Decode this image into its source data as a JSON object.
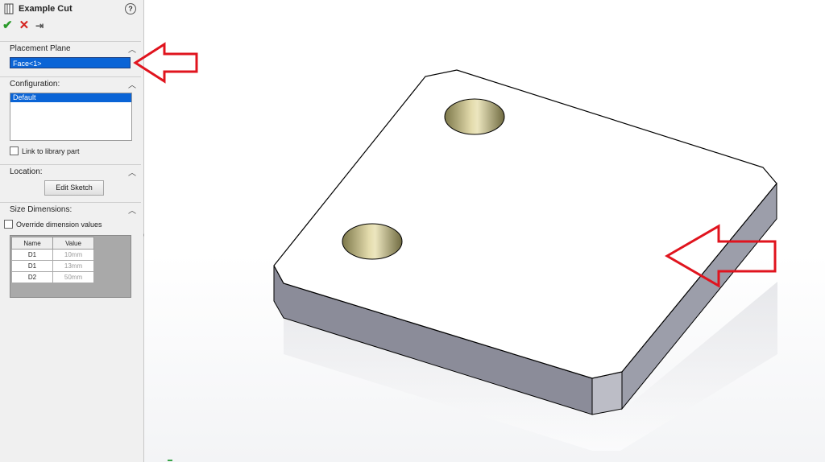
{
  "panel": {
    "title": "Example Cut",
    "help_glyph": "?",
    "actions": {
      "ok": "✔",
      "cancel": "✕",
      "pin": "⇥"
    }
  },
  "placement_plane": {
    "label": "Placement Plane",
    "value": "Face<1>"
  },
  "configuration": {
    "label": "Configuration:",
    "items": [
      "Default"
    ],
    "link_label": "Link to library part"
  },
  "location": {
    "label": "Location:",
    "edit_sketch": "Edit Sketch"
  },
  "size_dimensions": {
    "label": "Size Dimensions:",
    "override_label": "Override dimension values",
    "columns": [
      "Name",
      "Value"
    ],
    "rows": [
      {
        "name": "D1",
        "value": "10mm"
      },
      {
        "name": "D1",
        "value": "13mm"
      },
      {
        "name": "D2",
        "value": "50mm"
      }
    ]
  },
  "colors": {
    "accent_arrow": "#e0141e",
    "selection": "#0a64d6",
    "hole": "#b6ac6a",
    "part_face": "#ffffff",
    "part_side": "#8e8f9c"
  }
}
